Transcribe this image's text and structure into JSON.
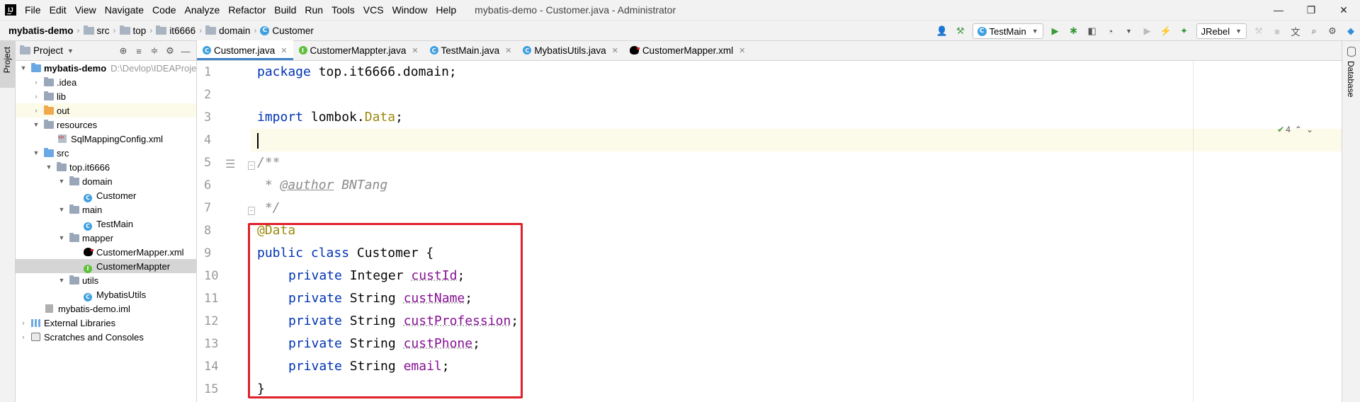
{
  "menubar": {
    "logo": "IJ",
    "items": [
      "File",
      "Edit",
      "View",
      "Navigate",
      "Code",
      "Analyze",
      "Refactor",
      "Build",
      "Run",
      "Tools",
      "VCS",
      "Window",
      "Help"
    ],
    "window_title": "mybatis-demo - Customer.java - Administrator",
    "controls": {
      "minimize": "—",
      "restore": "❐",
      "close": "✕"
    }
  },
  "navbar": {
    "breadcrumb": [
      "mybatis-demo",
      "src",
      "top",
      "it6666",
      "domain",
      "Customer"
    ],
    "run_config": "TestMain",
    "jrebel": "JRebel"
  },
  "left_stripe": {
    "project_label": "Project"
  },
  "right_stripe": {
    "database_label": "Database"
  },
  "project_panel": {
    "title": "Project",
    "tree": [
      {
        "label": "mybatis-demo",
        "path": "D:\\Devlop\\IDEAProje",
        "bold": true
      },
      {
        "label": ".idea"
      },
      {
        "label": "lib"
      },
      {
        "label": "out"
      },
      {
        "label": "resources"
      },
      {
        "label": "SqlMappingConfig.xml"
      },
      {
        "label": "src"
      },
      {
        "label": "top.it6666"
      },
      {
        "label": "domain"
      },
      {
        "label": "Customer"
      },
      {
        "label": "main"
      },
      {
        "label": "TestMain"
      },
      {
        "label": "mapper"
      },
      {
        "label": "CustomerMapper.xml"
      },
      {
        "label": "CustomerMappter"
      },
      {
        "label": "utils"
      },
      {
        "label": "MybatisUtils"
      },
      {
        "label": "mybatis-demo.iml"
      },
      {
        "label": "External Libraries"
      },
      {
        "label": "Scratches and Consoles"
      }
    ]
  },
  "editor_tabs": [
    "Customer.java",
    "CustomerMappter.java",
    "TestMain.java",
    "MybatisUtils.java",
    "CustomerMapper.xml"
  ],
  "editor": {
    "line_numbers": [
      "1",
      "2",
      "3",
      "4",
      "5",
      "6",
      "7",
      "8",
      "9",
      "10",
      "11",
      "12",
      "13",
      "14",
      "15"
    ],
    "code": {
      "l1_kw": "package",
      "l1_rest": " top.it6666.domain;",
      "l3_kw": "import",
      "l3_mid": " lombok.",
      "l3_ann": "Data",
      "l3_end": ";",
      "l5": "/**",
      "l6_pre": " * ",
      "l6_tag": "@author",
      "l6_post": " BNTang",
      "l7": " */",
      "l8": "@Data",
      "l9_kw": "public class",
      "l9_rest": " Customer {",
      "fields": [
        {
          "kw": "private",
          "type": " Integer ",
          "name": "custId",
          "end": ";"
        },
        {
          "kw": "private",
          "type": " String ",
          "name": "custName",
          "end": ";"
        },
        {
          "kw": "private",
          "type": " String ",
          "name": "custProfession",
          "end": ";"
        },
        {
          "kw": "private",
          "type": " String ",
          "name": "custPhone",
          "end": ";"
        },
        {
          "kw": "private",
          "type": " String ",
          "name": "email",
          "end": ";"
        }
      ],
      "l15": "}"
    },
    "inspection_count": "4"
  },
  "colors": {
    "highlight_box": "#e0202a",
    "tab_underline": "#4083c9",
    "keyword": "#0033b3",
    "annotation": "#9e880d",
    "field": "#871094"
  }
}
